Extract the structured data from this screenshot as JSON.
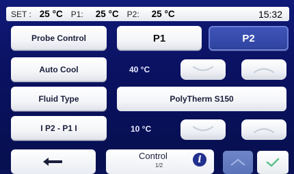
{
  "status_bar": {
    "set_label": "SET :",
    "set_value": "25 °C",
    "p1_label": "P1:",
    "p1_value": "25 °C",
    "p2_label": "P2:",
    "p2_value": "25 °C",
    "time": "15:32"
  },
  "rows": {
    "probe_control": {
      "label": "Probe Control",
      "tab_p1": "P1",
      "tab_p2": "P2",
      "selected": "P2"
    },
    "auto_cool": {
      "label": "Auto Cool",
      "value": "40 °C"
    },
    "fluid_type": {
      "label": "Fluid Type",
      "value": "PolyTherm S150"
    },
    "p2_minus_p1": {
      "label": "I P2 - P1 I",
      "value": "10 °C"
    }
  },
  "bottom_bar": {
    "back_icon": "back-arrow-icon",
    "control_label": "Control",
    "control_page": "1/2",
    "info_icon": "info-icon",
    "info_glyph": "i",
    "nav_up_icon": "chevron-up-icon",
    "ok_icon": "check-icon"
  },
  "colors": {
    "background": "#0b1258",
    "active_tab": "#3f55b8",
    "info_icon": "#21308e",
    "nav_up": "#6e86c8",
    "check": "#5fc28a"
  }
}
